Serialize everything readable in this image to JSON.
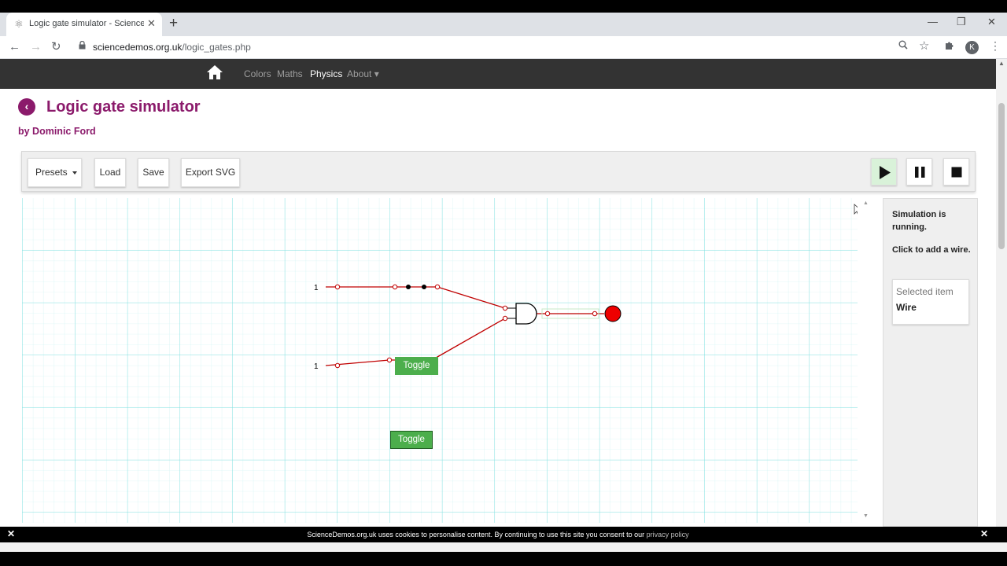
{
  "browser": {
    "tab_title": "Logic gate simulator - ScienceDe",
    "tab_close": "✕",
    "new_tab": "+",
    "url_domain": "sciencedemos.org.uk",
    "url_path": "/logic_gates.php",
    "profile_initial": "K",
    "window_minimize": "—",
    "window_maximize": "❐",
    "window_close": "✕"
  },
  "site_nav": {
    "items": [
      "Colors",
      "Maths",
      "Physics",
      "About ▾"
    ],
    "active": "Physics"
  },
  "header": {
    "back_symbol": "‹",
    "title": "Logic gate simulator",
    "byline": "by Dominic Ford"
  },
  "toolbar": {
    "presets_label": "Presets",
    "load_label": "Load",
    "save_label": "Save",
    "export_label": "Export SVG",
    "play_icon": "play-icon",
    "pause_icon": "pause-icon",
    "stop_icon": "stop-icon"
  },
  "circuit": {
    "input_top_value": "1",
    "input_bottom_value": "1",
    "toggle_top_label": "Toggle",
    "toggle_bottom_label": "Toggle",
    "gate_type": "AND",
    "output_state": "on",
    "colors": {
      "wire": "#c00000",
      "grid_major": "#7ee0e0",
      "grid_minor": "#c8f2f2",
      "output_on": "#ee0000",
      "toggle": "#4cae4c"
    }
  },
  "sidebar": {
    "status_line": "Simulation is running.",
    "hint_line": "Click to add a wire.",
    "selected_label": "Selected item",
    "selected_value": "Wire"
  },
  "cookie_bar": {
    "text": "ScienceDemos.org.uk uses cookies to personalise content. By continuing to use this site you consent to our",
    "link": "privacy policy",
    "close_left": "✕",
    "close_right": "✕"
  }
}
